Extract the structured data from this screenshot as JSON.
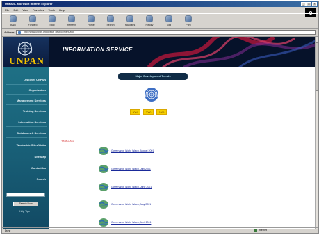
{
  "window": {
    "title": "UNPAN - Microsoft Internet Explorer",
    "controls": [
      "_",
      "□",
      "×"
    ]
  },
  "menu": [
    "File",
    "Edit",
    "View",
    "Favorites",
    "Tools",
    "Help"
  ],
  "toolbar": [
    {
      "label": "Back",
      "icon": "back-arrow-icon"
    },
    {
      "label": "Forward",
      "icon": "forward-arrow-icon"
    },
    {
      "label": "Stop",
      "icon": "stop-icon"
    },
    {
      "label": "Refresh",
      "icon": "refresh-icon"
    },
    {
      "label": "Home",
      "icon": "home-icon"
    },
    {
      "label": "Search",
      "icon": "search-icon"
    },
    {
      "label": "Favorites",
      "icon": "favorites-icon"
    },
    {
      "label": "History",
      "icon": "history-icon"
    },
    {
      "label": "Mail",
      "icon": "mail-icon"
    },
    {
      "label": "Print",
      "icon": "print-icon"
    }
  ],
  "address": {
    "label": "Address",
    "url": "http://www.unpan.org/dpepa_development.asp"
  },
  "banner": {
    "org": "UNPAN",
    "service": "INFORMATION SERVICE"
  },
  "sidebar": {
    "items": [
      "Discover UNPAN",
      "Organization",
      "Management Services",
      "Training Services",
      "Information Services",
      "Databases & Services",
      "Worldwide Sites/Links",
      "Site Map",
      "Contact Us",
      "Search"
    ],
    "search_button": "Search Now",
    "help_link": "Help Tips"
  },
  "main": {
    "page_title": "Major Development Trends",
    "years": [
      "2001",
      "2000",
      "1999"
    ],
    "year_label": "Year 2001",
    "articles": [
      "Governance World Watch, August 2001",
      "Governance World Watch, July 2001",
      "Governance World Watch, June 2001",
      "Governance World Watch, May 2001",
      "Governance World Watch, April 2001"
    ]
  },
  "status": {
    "text": "Done",
    "zone": "Internet"
  },
  "colors": {
    "banner_bg": "#06122a",
    "sidebar_bg": "#1e7085",
    "year_button": "#f5d000",
    "link": "#1a2a9a",
    "year_label": "#d63838"
  }
}
